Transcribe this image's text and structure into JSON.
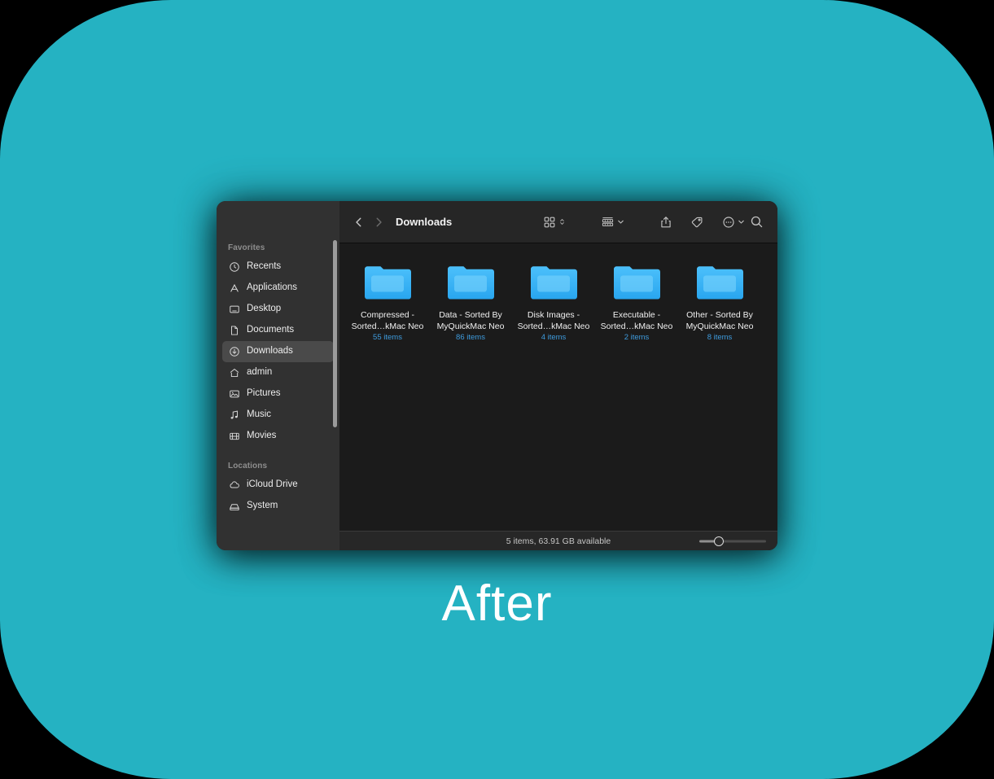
{
  "caption": {
    "text": "After"
  },
  "colors": {
    "backdrop_teal": "#25b2c2",
    "page_background": "#000000",
    "sidebar": "#313131",
    "content": "#1b1b1b",
    "toolbar": "#262626",
    "folder_blue": "#42b5f4",
    "count_blue": "#3e9bdd",
    "selection": "#4a4a4a"
  },
  "window": {
    "toolbar": {
      "back_icon": "chevron-left-icon",
      "forward_icon": "chevron-right-icon",
      "title": "Downloads",
      "view_grid_icon": "grid-view-icon",
      "view_grid_chevron_icon": "chevron-up-down-icon",
      "group_icon": "group-by-icon",
      "group_chevron_icon": "chevron-down-icon",
      "share_icon": "share-icon",
      "tag_icon": "tag-icon",
      "more_icon": "more-options-icon",
      "more_chevron_icon": "chevron-down-icon",
      "search_icon": "search-icon"
    },
    "sidebar": {
      "sections": [
        {
          "header": "Favorites",
          "items": [
            {
              "label": "Recents",
              "icon": "clock-icon",
              "selected": false
            },
            {
              "label": "Applications",
              "icon": "applications-icon",
              "selected": false
            },
            {
              "label": "Desktop",
              "icon": "desktop-icon",
              "selected": false
            },
            {
              "label": "Documents",
              "icon": "document-icon",
              "selected": false
            },
            {
              "label": "Downloads",
              "icon": "download-icon",
              "selected": true
            },
            {
              "label": "admin",
              "icon": "home-icon",
              "selected": false
            },
            {
              "label": "Pictures",
              "icon": "pictures-icon",
              "selected": false
            },
            {
              "label": "Music",
              "icon": "music-note-icon",
              "selected": false
            },
            {
              "label": "Movies",
              "icon": "movies-icon",
              "selected": false
            }
          ]
        },
        {
          "header": "Locations",
          "items": [
            {
              "label": "iCloud Drive",
              "icon": "cloud-icon",
              "selected": false
            },
            {
              "label": "System",
              "icon": "harddisk-icon",
              "selected": false
            }
          ]
        }
      ]
    },
    "files": [
      {
        "name_line1": "Compressed -",
        "name_line2": "Sorted…kMac Neo",
        "count": "55 items",
        "icon": "folder-icon"
      },
      {
        "name_line1": "Data - Sorted By",
        "name_line2": "MyQuickMac Neo",
        "count": "86 items",
        "icon": "folder-icon"
      },
      {
        "name_line1": "Disk Images -",
        "name_line2": "Sorted…kMac Neo",
        "count": "4 items",
        "icon": "folder-icon"
      },
      {
        "name_line1": "Executable -",
        "name_line2": "Sorted…kMac Neo",
        "count": "2 items",
        "icon": "folder-icon"
      },
      {
        "name_line1": "Other - Sorted By",
        "name_line2": "MyQuickMac Neo",
        "count": "8 items",
        "icon": "folder-icon"
      }
    ],
    "statusbar": {
      "text": "5 items, 63.91 GB available",
      "zoom_slider": "icon-size-slider"
    }
  }
}
